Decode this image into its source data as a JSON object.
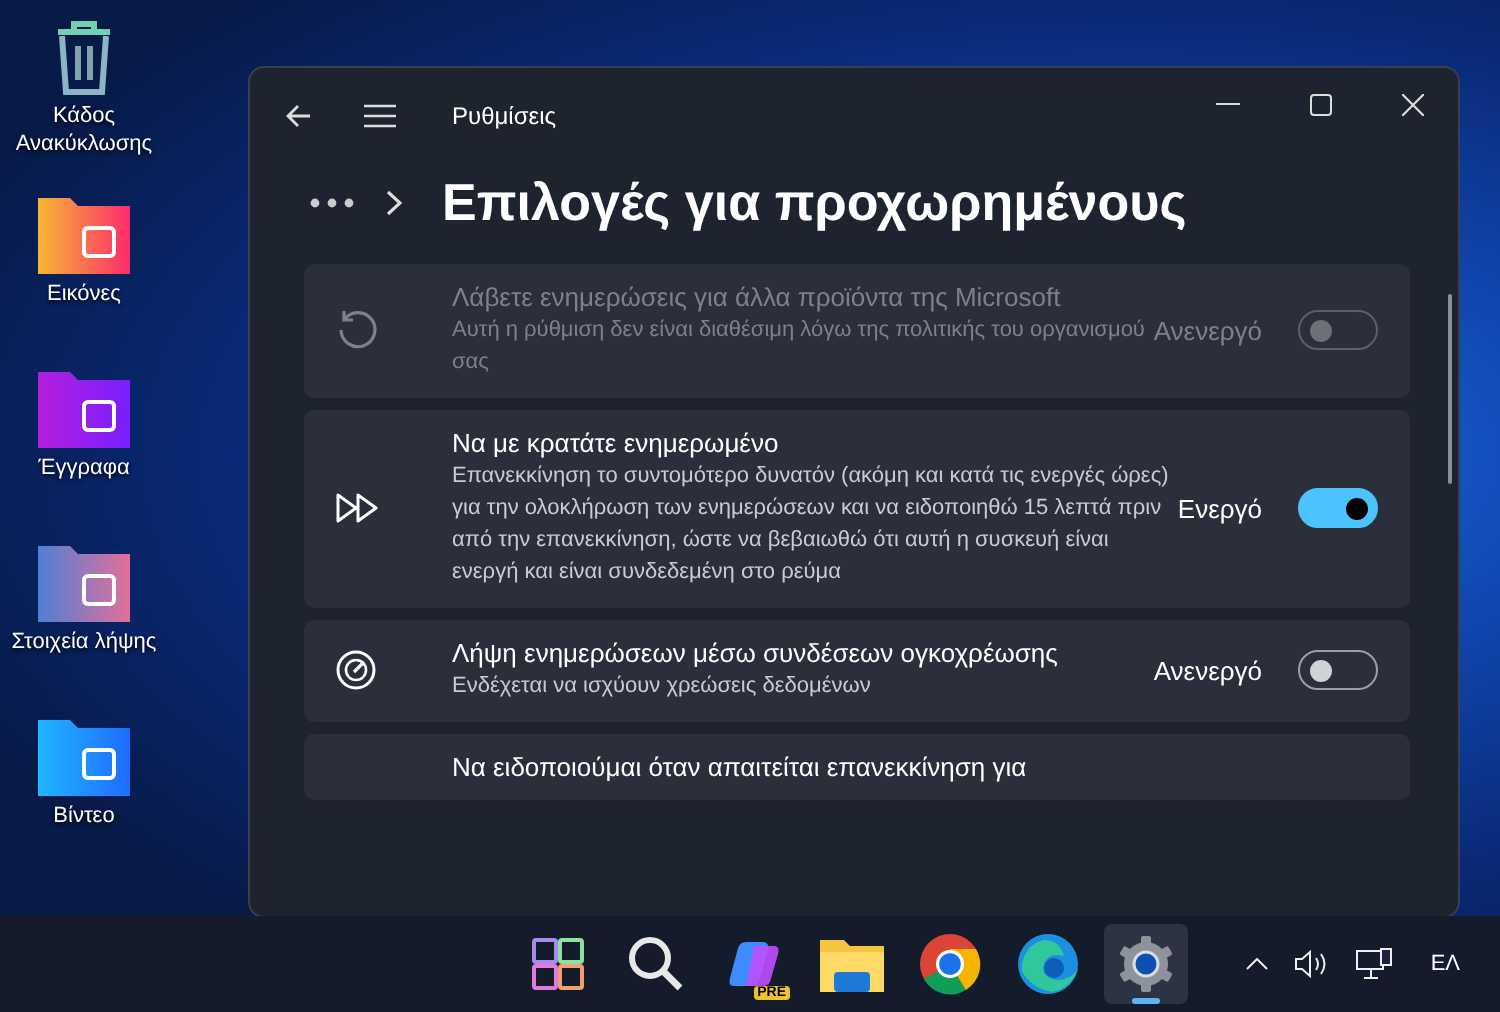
{
  "desktop_icons": [
    {
      "label": "Κάδος Ανακύκλωσης"
    },
    {
      "label": "Εικόνες"
    },
    {
      "label": "Έγγραφα"
    },
    {
      "label": "Στοιχεία λήψης"
    },
    {
      "label": "Βίντεο"
    }
  ],
  "window": {
    "title": "Ρυθμίσεις",
    "heading": "Επιλογές για προχωρημένους"
  },
  "settings": [
    {
      "title": "Λάβετε ενημερώσεις για άλλα προϊόντα της Microsoft",
      "description": "Αυτή η ρύθμιση δεν είναι διαθέσιμη λόγω της πολιτικής του οργανισμού σας",
      "status": "Ανενεργό",
      "on": false,
      "disabled": true
    },
    {
      "title": "Να με κρατάτε ενημερωμένο",
      "description": "Επανεκκίνηση το συντομότερο δυνατόν (ακόμη και κατά τις ενεργές ώρες) για την ολοκλήρωση των ενημερώσεων και να ειδοποιηθώ 15 λεπτά πριν από την επανεκκίνηση, ώστε να βεβαιωθώ ότι αυτή η συσκευή είναι ενεργή και είναι συνδεδεμένη στο ρεύμα",
      "status": "Ενεργό",
      "on": true,
      "disabled": false
    },
    {
      "title": "Λήψη ενημερώσεων μέσω συνδέσεων ογκοχρέωσης",
      "description": "Ενδέχεται να ισχύουν χρεώσεις δεδομένων",
      "status": "Ανενεργό",
      "on": false,
      "disabled": false
    },
    {
      "title": "Να ειδοποιούμαι όταν απαιτείται επανεκκίνηση για"
    }
  ],
  "taskbar": {
    "apps": [
      {
        "selected": false
      },
      {
        "selected": false
      },
      {
        "selected": false,
        "badge": "PRE"
      },
      {
        "selected": false
      },
      {
        "selected": false
      },
      {
        "selected": false
      },
      {
        "selected": true
      }
    ],
    "language": "ΕΛ"
  }
}
